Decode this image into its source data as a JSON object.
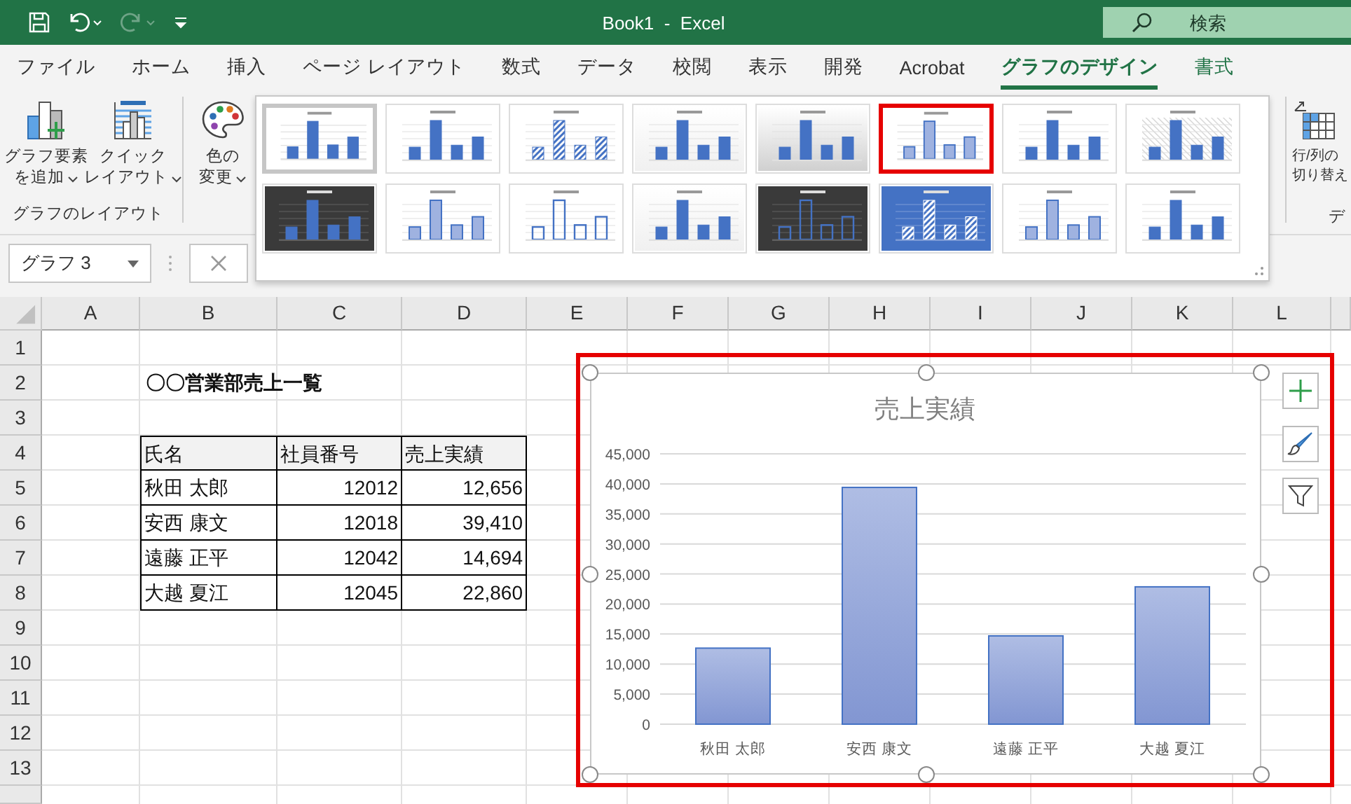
{
  "title_bar": {
    "title": "Book1  -  Excel",
    "search": {
      "placeholder": "検索"
    }
  },
  "ribbon_tabs": [
    {
      "label": "ファイル",
      "selected": false,
      "kind": "standard"
    },
    {
      "label": "ホーム",
      "selected": false,
      "kind": "standard"
    },
    {
      "label": "挿入",
      "selected": false,
      "kind": "standard"
    },
    {
      "label": "ページ レイアウト",
      "selected": false,
      "kind": "standard"
    },
    {
      "label": "数式",
      "selected": false,
      "kind": "standard"
    },
    {
      "label": "データ",
      "selected": false,
      "kind": "standard"
    },
    {
      "label": "校閲",
      "selected": false,
      "kind": "standard"
    },
    {
      "label": "表示",
      "selected": false,
      "kind": "standard"
    },
    {
      "label": "開発",
      "selected": false,
      "kind": "standard"
    },
    {
      "label": "Acrobat",
      "selected": false,
      "kind": "standard"
    },
    {
      "label": "グラフのデザイン",
      "selected": true,
      "kind": "contextual"
    },
    {
      "label": "書式",
      "selected": false,
      "kind": "contextual"
    }
  ],
  "ribbon": {
    "layout_group": {
      "buttons": [
        {
          "lines": [
            "グラフ要素",
            "を追加"
          ]
        },
        {
          "lines": [
            "クイック",
            "レイアウト"
          ]
        }
      ],
      "label": "グラフのレイアウト"
    },
    "color_button": {
      "lines": [
        "色の",
        "変更"
      ]
    },
    "switch_button": {
      "lines": [
        "行/列の",
        "切り替え"
      ]
    },
    "data_group_label": "デ"
  },
  "chart_styles": [
    {
      "kind": "standard",
      "selected": false,
      "hovered": true
    },
    {
      "kind": "standard",
      "selected": false,
      "hovered": false
    },
    {
      "kind": "striped",
      "selected": false,
      "hovered": false
    },
    {
      "kind": "shaded",
      "selected": false,
      "hovered": false
    },
    {
      "kind": "gray",
      "selected": false,
      "hovered": false
    },
    {
      "kind": "faded",
      "selected": true,
      "hovered": false
    },
    {
      "kind": "standard",
      "selected": false,
      "hovered": false
    },
    {
      "kind": "hatched",
      "selected": false,
      "hovered": false
    },
    {
      "kind": "dark",
      "selected": false,
      "hovered": false
    },
    {
      "kind": "faded",
      "selected": false,
      "hovered": false
    },
    {
      "kind": "outline",
      "selected": false,
      "hovered": false
    },
    {
      "kind": "shaded",
      "selected": false,
      "hovered": false
    },
    {
      "kind": "darkoutline",
      "selected": false,
      "hovered": false
    },
    {
      "kind": "bluestriped",
      "selected": false,
      "hovered": false
    },
    {
      "kind": "faded",
      "selected": false,
      "hovered": false
    },
    {
      "kind": "standard",
      "selected": false,
      "hovered": false
    }
  ],
  "name_box": {
    "value": "グラフ 3"
  },
  "sheet": {
    "columns": [
      "A",
      "B",
      "C",
      "D",
      "E",
      "F",
      "G",
      "H",
      "I",
      "J",
      "K",
      "L"
    ],
    "rows": [
      "1",
      "2",
      "3",
      "4",
      "5",
      "6",
      "7",
      "8",
      "9",
      "10",
      "11",
      "12",
      "13"
    ],
    "title": "〇〇営業部売上一覧",
    "table": {
      "columns": [
        "氏名",
        "社員番号",
        "売上実績"
      ],
      "rows": [
        [
          "秋田 太郎",
          "12012",
          "12,656"
        ],
        [
          "安西 康文",
          "12018",
          "39,410"
        ],
        [
          "遠藤 正平",
          "12042",
          "14,694"
        ],
        [
          "大越 夏江",
          "12045",
          "22,860"
        ]
      ]
    }
  },
  "chart": {
    "chart_data": {
      "type": "bar",
      "title": "売上実績",
      "categories": [
        "秋田 太郎",
        "安西 康文",
        "遠藤 正平",
        "大越 夏江"
      ],
      "values": [
        12656,
        39410,
        14694,
        22860
      ],
      "ylim": [
        0,
        45000
      ],
      "grid": true,
      "yticks": [
        {
          "value": 0,
          "label": "0"
        },
        {
          "value": 5000,
          "label": "5,000"
        },
        {
          "value": 10000,
          "label": "10,000"
        },
        {
          "value": 15000,
          "label": "15,000"
        },
        {
          "value": 20000,
          "label": "20,000"
        },
        {
          "value": 25000,
          "label": "25,000"
        },
        {
          "value": 30000,
          "label": "30,000"
        },
        {
          "value": 35000,
          "label": "35,000"
        },
        {
          "value": 40000,
          "label": "40,000"
        },
        {
          "value": 45000,
          "label": "45,000"
        }
      ]
    }
  }
}
